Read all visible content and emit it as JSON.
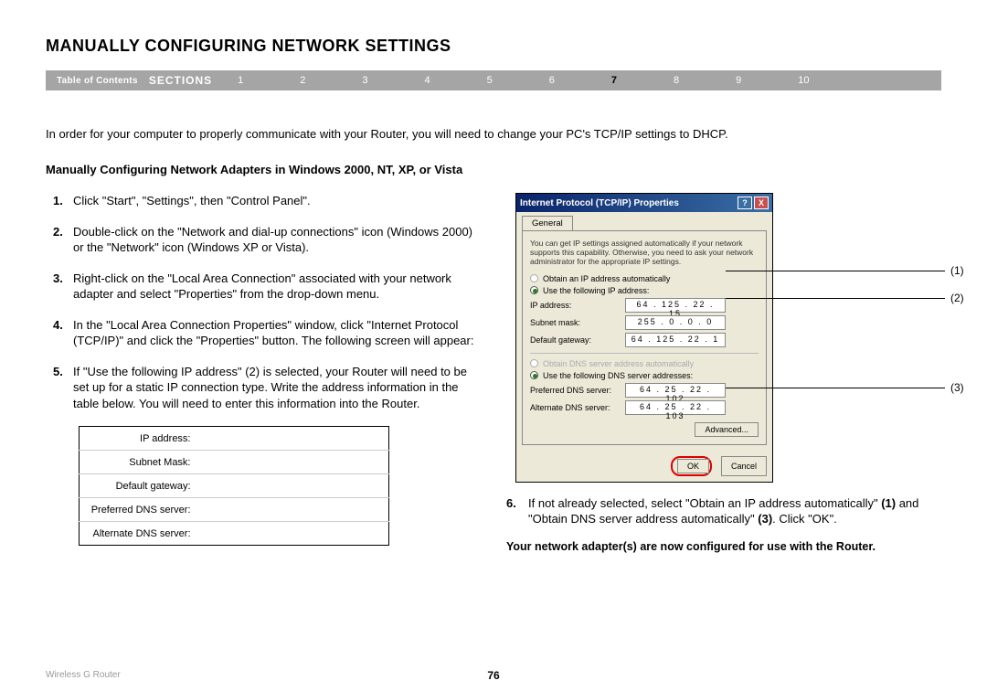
{
  "page_title": "MANUALLY CONFIGURING NETWORK SETTINGS",
  "nav": {
    "toc": "Table of Contents",
    "sections": "SECTIONS",
    "items": [
      "1",
      "2",
      "3",
      "4",
      "5",
      "6",
      "7",
      "8",
      "9",
      "10"
    ],
    "active_index": 6
  },
  "intro": "In order for your computer to properly communicate with your Router, you will need to change your PC's TCP/IP settings to DHCP.",
  "subheading": "Manually Configuring Network Adapters in Windows 2000, NT, XP, or Vista",
  "steps": [
    "Click \"Start\", \"Settings\", then \"Control Panel\".",
    "Double-click on the \"Network and dial-up connections\" icon (Windows 2000) or the \"Network\" icon (Windows XP or Vista).",
    "Right-click on the \"Local Area Connection\" associated with your network adapter and select \"Properties\" from the drop-down menu.",
    "In the \"Local Area Connection Properties\" window, click \"Internet Protocol (TCP/IP)\" and click the \"Properties\" button. The following screen will appear:",
    "If \"Use the following IP address\" (2) is selected, your Router will need to be set up for a static IP connection type. Write the address information in the table below. You will need to enter this information into the Router."
  ],
  "table_rows": [
    "IP address:",
    "Subnet Mask:",
    "Default gateway:",
    "Preferred DNS server:",
    "Alternate DNS server:"
  ],
  "dialog": {
    "title": "Internet Protocol (TCP/IP) Properties",
    "tab": "General",
    "intro": "You can get IP settings assigned automatically if your network supports this capability. Otherwise, you need to ask your network administrator for the appropriate IP settings.",
    "radio_auto_ip": "Obtain an IP address automatically",
    "radio_use_ip": "Use the following IP address:",
    "ip_address_lbl": "IP address:",
    "ip_address_val": "64 . 125 . 22 . 15",
    "subnet_lbl": "Subnet mask:",
    "subnet_val": "255 . 0 . 0 . 0",
    "gateway_lbl": "Default gateway:",
    "gateway_val": "64 . 125 . 22 . 1",
    "radio_auto_dns": "Obtain DNS server address automatically",
    "radio_use_dns": "Use the following DNS server addresses:",
    "pref_dns_lbl": "Preferred DNS server:",
    "pref_dns_val": "64 . 25 . 22 . 102",
    "alt_dns_lbl": "Alternate DNS server:",
    "alt_dns_val": "64 . 25 . 22 . 103",
    "advanced": "Advanced...",
    "ok": "OK",
    "cancel": "Cancel"
  },
  "callouts": {
    "c1": "(1)",
    "c2": "(2)",
    "c3": "(3)"
  },
  "step6": "If not already selected, select \"Obtain an IP address automatically\" (1) and \"Obtain DNS server address automatically\" (3). Click \"OK\".",
  "confirm": "Your network adapter(s) are now configured for use with the Router.",
  "footer_product": "Wireless G Router",
  "page_number": "76"
}
